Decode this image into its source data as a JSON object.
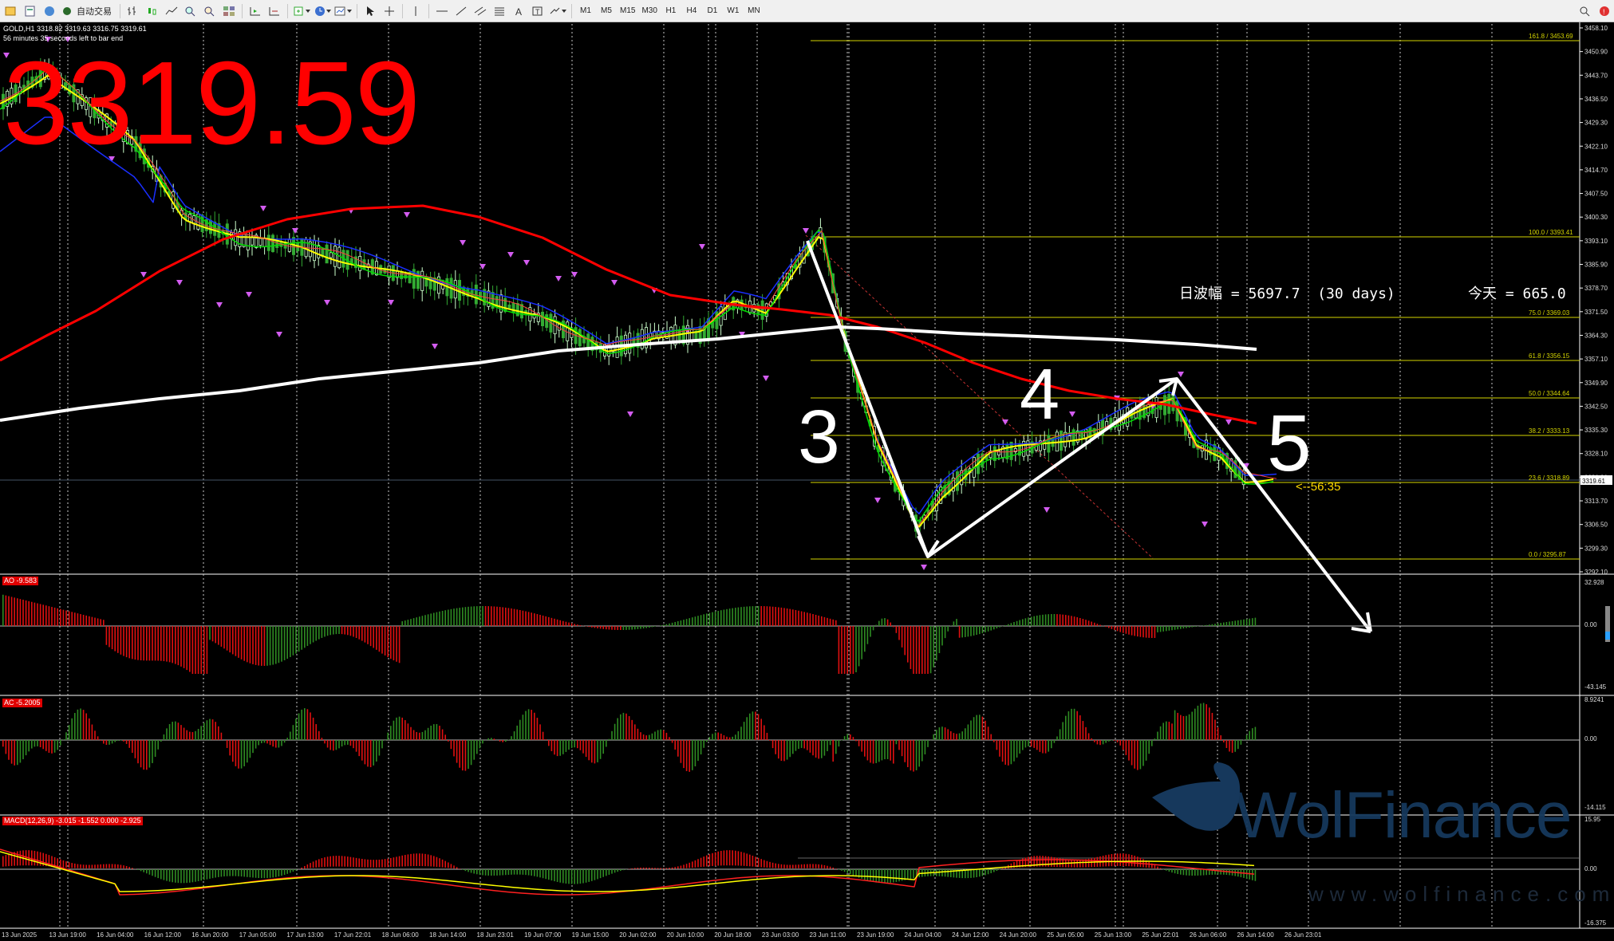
{
  "toolbar": {
    "auto_trading_label": "自动交易",
    "timeframes": [
      "M1",
      "M5",
      "M15",
      "M30",
      "H1",
      "H4",
      "D1",
      "W1",
      "MN"
    ]
  },
  "chart": {
    "symbol_line": "GOLD,H1  3318.82 3319.63 3316.75 3319.61",
    "timer_line": "56 minutes 35 seconds left to bar end",
    "big_price": "3319.59",
    "current_price_tag": "3319.61",
    "range_label": "日波幅 = 5697.7  (30 days)",
    "today_label": "今天 = 665.0",
    "countdown": "<--56:35",
    "wave_labels": [
      "3",
      "4",
      "5"
    ]
  },
  "fib_levels": [
    {
      "label": "161.8  /  3453.69"
    },
    {
      "label": "100.0  /  3393.41"
    },
    {
      "label": "75.0  /  3369.03"
    },
    {
      "label": "61.8  /  3356.15"
    },
    {
      "label": "50.0  /  3344.64"
    },
    {
      "label": "38.2  /  3333.13"
    },
    {
      "label": "23.6  /  3318.89"
    },
    {
      "label": "0.0  /  3295.87"
    }
  ],
  "price_axis": [
    "3458.10",
    "3450.90",
    "3443.70",
    "3436.50",
    "3429.30",
    "3422.10",
    "3414.70",
    "3407.50",
    "3400.30",
    "3393.10",
    "3385.90",
    "3378.70",
    "3371.50",
    "3364.30",
    "3357.10",
    "3349.90",
    "3342.50",
    "3335.30",
    "3328.10",
    "3320.90",
    "3313.70",
    "3306.50",
    "3299.30",
    "3292.10"
  ],
  "indicators": {
    "ao": {
      "label": "AO -9.583",
      "axis": [
        "32.928",
        "0.00",
        "-43.145"
      ]
    },
    "ac": {
      "label": "AC -5.2005",
      "axis": [
        "8.9241",
        "0.00",
        "-14.115"
      ]
    },
    "macd": {
      "label": "MACD(12,26,9) -3.015 -1.552 0.000 -2.925",
      "axis": [
        "15.95",
        "0.00",
        "-16.375"
      ]
    }
  },
  "time_axis": [
    "13 Jun 2025",
    "13 Jun 19:00",
    "16 Jun 04:00",
    "16 Jun 12:00",
    "16 Jun 20:00",
    "17 Jun 05:00",
    "17 Jun 13:00",
    "17 Jun 22:01",
    "18 Jun 06:00",
    "18 Jun 14:00",
    "18 Jun 23:01",
    "19 Jun 07:00",
    "19 Jun 15:00",
    "20 Jun 02:00",
    "20 Jun 10:00",
    "20 Jun 18:00",
    "23 Jun 03:00",
    "23 Jun 11:00",
    "23 Jun 19:00",
    "24 Jun 04:00",
    "24 Jun 12:00",
    "24 Jun 20:00",
    "25 Jun 05:00",
    "25 Jun 13:00",
    "25 Jun 22:01",
    "26 Jun 06:00",
    "26 Jun 14:00",
    "26 Jun 23:01"
  ],
  "watermark": {
    "brand": "WolFinance",
    "url": "www.wolfinance.com"
  },
  "colors": {
    "bull": "#ccffcc",
    "bear": "#33aa33",
    "ema_red": "#ff0000",
    "ema_white": "#ffffff",
    "fib": "#d4d400",
    "ma_blue": "#1a2fff",
    "ma_yellow": "#ffff00",
    "ma_green": "#00dd00",
    "ao_up": "#2e8b22",
    "ao_down": "#e01010"
  }
}
